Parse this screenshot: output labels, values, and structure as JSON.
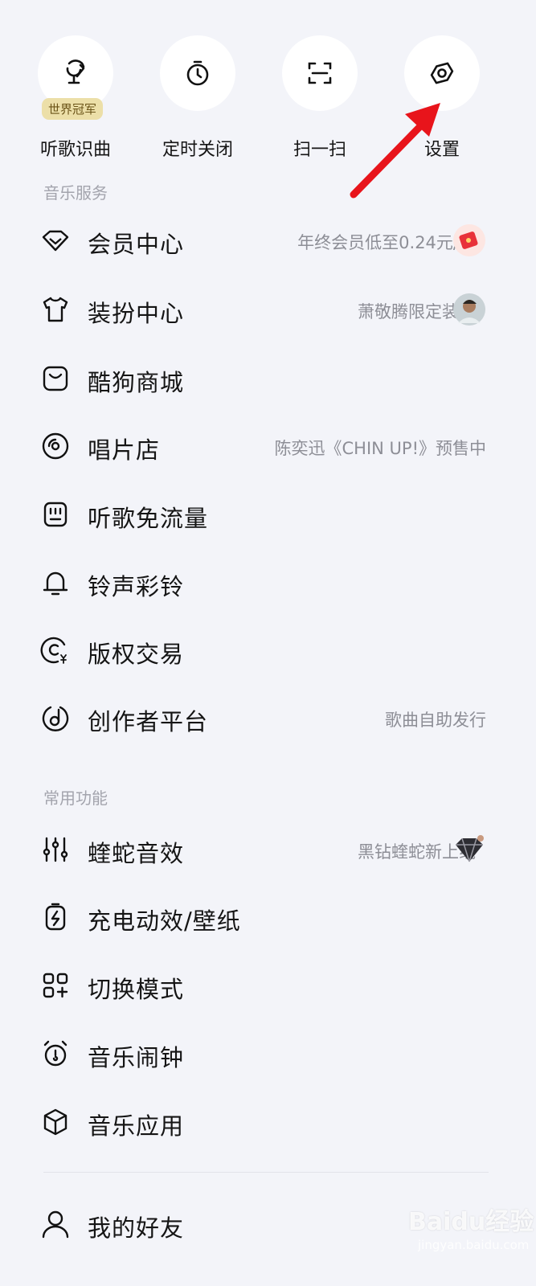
{
  "quick_actions": [
    {
      "label": "听歌识曲",
      "badge": "世界冠军",
      "icon": "mic-recognize-icon"
    },
    {
      "label": "定时关闭",
      "icon": "timer-icon"
    },
    {
      "label": "扫一扫",
      "icon": "scan-icon"
    },
    {
      "label": "设置",
      "icon": "gear-icon"
    }
  ],
  "sections": {
    "music_services": {
      "title": "音乐服务",
      "items": [
        {
          "label": "会员中心",
          "note": "年终会员低至0.24元/天",
          "icon": "diamond-icon",
          "thumb": "red-envelope-icon"
        },
        {
          "label": "装扮中心",
          "note": "萧敬腾限定装扮",
          "icon": "tshirt-icon",
          "thumb": "avatar"
        },
        {
          "label": "酷狗商城",
          "note": "",
          "icon": "shopping-bag-icon"
        },
        {
          "label": "唱片店",
          "note": "陈奕迅《CHIN UP!》预售中",
          "icon": "vinyl-icon"
        },
        {
          "label": "听歌免流量",
          "note": "",
          "icon": "sim-card-icon"
        },
        {
          "label": "铃声彩铃",
          "note": "",
          "icon": "bell-icon"
        },
        {
          "label": "版权交易",
          "note": "",
          "icon": "copyright-yen-icon"
        },
        {
          "label": "创作者平台",
          "note": "歌曲自助发行",
          "icon": "music-note-circle-icon"
        }
      ]
    },
    "common_functions": {
      "title": "常用功能",
      "items": [
        {
          "label": "蝰蛇音效",
          "note": "黑钻蝰蛇新上线",
          "icon": "equalizer-icon",
          "thumb": "black-diamond-icon"
        },
        {
          "label": "充电动效/壁纸",
          "note": "",
          "icon": "battery-bolt-icon"
        },
        {
          "label": "切换模式",
          "note": "",
          "icon": "grid-switch-icon"
        },
        {
          "label": "音乐闹钟",
          "note": "",
          "icon": "alarm-clock-icon"
        },
        {
          "label": "音乐应用",
          "note": "",
          "icon": "cube-icon"
        }
      ]
    },
    "friends": {
      "items": [
        {
          "label": "我的好友",
          "note": "",
          "icon": "user-icon"
        }
      ]
    }
  },
  "colors": {
    "background": "#f3f4f9",
    "badge_bg": "#ecdfa8",
    "arrow": "#e8141b",
    "note_text": "#8d8e96"
  },
  "watermark": {
    "main": "Baidu经验",
    "sub": "jingyan.baidu.com"
  }
}
